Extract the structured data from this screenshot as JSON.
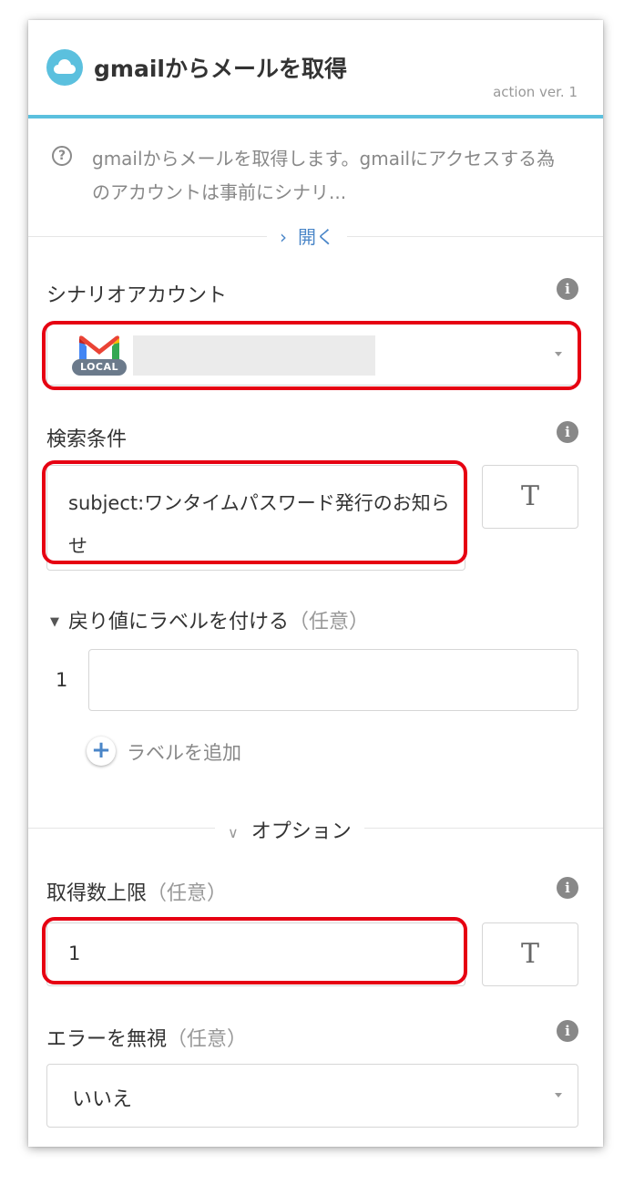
{
  "header": {
    "title": "gmailからメールを取得",
    "version": "action ver. 1",
    "icon": "cloud-icon",
    "accent_color": "#5bc0de"
  },
  "description": {
    "text": "gmailからメールを取得します。gmailにアクセスする為のアカウントは事前にシナリ...",
    "icon": "question-circle-icon",
    "toggle_label": "開く"
  },
  "fields": {
    "account": {
      "label": "シナリオアカウント",
      "badge": "LOCAL",
      "service_icon": "gmail-icon"
    },
    "search": {
      "label": "検索条件",
      "value": "subject:ワンタイムパスワード発行のお知らせ",
      "text_button": "T"
    },
    "return_label": {
      "label": "戻り値にラベルを付ける",
      "optional": "（任意）",
      "rows": [
        {
          "index": "1",
          "value": ""
        }
      ],
      "add_label": "ラベルを追加"
    },
    "options_toggle": "オプション",
    "max_count": {
      "label": "取得数上限",
      "optional": "（任意）",
      "value": "1",
      "text_button": "T"
    },
    "ignore_error": {
      "label": "エラーを無視",
      "optional": "（任意）",
      "value": "いいえ"
    }
  },
  "highlight_color": "#e60012"
}
